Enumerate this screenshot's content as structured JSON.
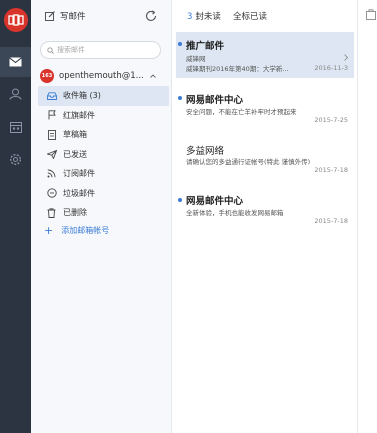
{
  "toolbar": {
    "compose_label": "写邮件",
    "unread_count": "3",
    "unread_label": "封未读",
    "mark_all_label": "全标已读"
  },
  "search": {
    "placeholder": "搜索邮件"
  },
  "account": {
    "badge": "163",
    "name": "openthemouth@1..."
  },
  "folders": [
    {
      "label": "收件箱 (3)",
      "icon": "inbox-icon",
      "selected": true
    },
    {
      "label": "红旗邮件",
      "icon": "flag-icon",
      "selected": false
    },
    {
      "label": "草稿箱",
      "icon": "draft-icon",
      "selected": false
    },
    {
      "label": "已发送",
      "icon": "sent-icon",
      "selected": false
    },
    {
      "label": "订阅邮件",
      "icon": "rss-icon",
      "selected": false
    },
    {
      "label": "垃圾邮件",
      "icon": "spam-icon",
      "selected": false
    },
    {
      "label": "已删除",
      "icon": "trash-icon",
      "selected": false
    }
  ],
  "add_account_label": "添加邮箱帐号",
  "mails": [
    {
      "from": "推广邮件",
      "line2": "威锋网",
      "line3": "威锋期刊2016年第40期：大学新...",
      "date": "2016-11-3",
      "unread": true,
      "selected": true
    },
    {
      "from": "网易邮件中心",
      "line2": "安全问题，不能在亡羊补牢时才预起来",
      "date": "2015-7-25",
      "unread": true,
      "selected": false
    },
    {
      "from": "多益网络",
      "line2": "请确认您的多益通行证帐号(特此 谨慎外传)",
      "date": "2015-7-18",
      "unread": false,
      "selected": false
    },
    {
      "from": "网易邮件中心",
      "line2": "全新体验，手机也能收发网易邮箱",
      "date": "2015-7-18",
      "unread": true,
      "selected": false
    }
  ],
  "colors": {
    "rail": "#2c3442",
    "accent": "#3b7cd6",
    "brand": "#d9342c",
    "selected": "#dde6f2"
  }
}
